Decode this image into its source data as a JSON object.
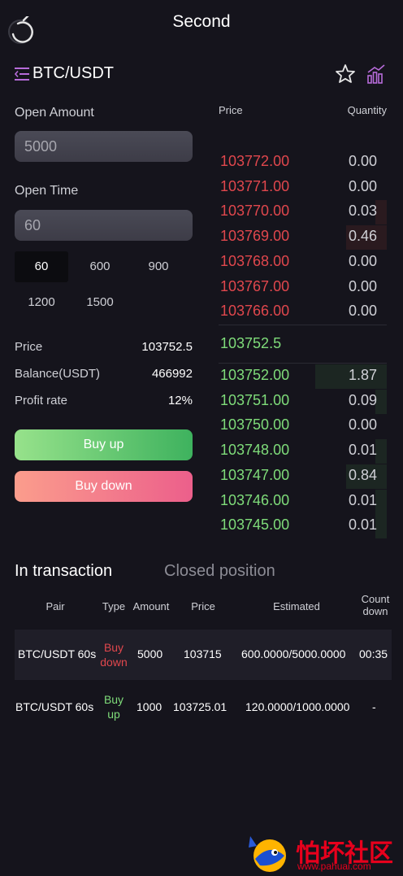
{
  "header": {
    "title": "Second"
  },
  "pair": {
    "name": "BTC/USDT"
  },
  "form": {
    "open_amount_label": "Open Amount",
    "open_amount_value": "5000",
    "open_time_label": "Open Time",
    "open_time_value": "60",
    "time_options": [
      "60",
      "600",
      "900",
      "1200",
      "1500"
    ],
    "selected_time": "60"
  },
  "info": {
    "price_label": "Price",
    "price_value": "103752.5",
    "balance_label": "Balance(USDT)",
    "balance_value": "466992",
    "profit_label": "Profit rate",
    "profit_value": "12%"
  },
  "buttons": {
    "buy_up": "Buy up",
    "buy_down": "Buy down"
  },
  "orderbook": {
    "price_header": "Price",
    "quantity_header": "Quantity",
    "asks": [
      {
        "price": "103772.00",
        "qty": "0.00",
        "depth": 0
      },
      {
        "price": "103771.00",
        "qty": "0.00",
        "depth": 0
      },
      {
        "price": "103770.00",
        "qty": "0.03",
        "depth": 0.03
      },
      {
        "price": "103769.00",
        "qty": "0.46",
        "depth": 0.46
      },
      {
        "price": "103768.00",
        "qty": "0.00",
        "depth": 0
      },
      {
        "price": "103767.00",
        "qty": "0.00",
        "depth": 0
      },
      {
        "price": "103766.00",
        "qty": "0.00",
        "depth": 0
      }
    ],
    "mid_price": "103752.5",
    "bids": [
      {
        "price": "103752.00",
        "qty": "1.87",
        "depth": 1.87
      },
      {
        "price": "103751.00",
        "qty": "0.09",
        "depth": 0.09
      },
      {
        "price": "103750.00",
        "qty": "0.00",
        "depth": 0
      },
      {
        "price": "103748.00",
        "qty": "0.01",
        "depth": 0.01
      },
      {
        "price": "103747.00",
        "qty": "0.84",
        "depth": 0.84
      },
      {
        "price": "103746.00",
        "qty": "0.01",
        "depth": 0.01
      },
      {
        "price": "103745.00",
        "qty": "0.01",
        "depth": 0.01
      }
    ]
  },
  "tabs": {
    "active": "In transaction",
    "inactive": "Closed position"
  },
  "table": {
    "headers": {
      "pair": "Pair",
      "type": "Type",
      "amount": "Amount",
      "price": "Price",
      "estimated": "Estimated",
      "countdown_1": "Count",
      "countdown_2": "down"
    },
    "rows": [
      {
        "pair": "BTC/USDT 60s",
        "type_1": "Buy",
        "type_2": "down",
        "direction": "down",
        "amount": "5000",
        "price": "103715",
        "estimated": "600.0000/5000.0000",
        "countdown": "00:35"
      },
      {
        "pair": "BTC/USDT 60s",
        "type_1": "Buy",
        "type_2": "up",
        "direction": "up",
        "amount": "1000",
        "price": "103725.01",
        "estimated": "120.0000/1000.0000",
        "countdown": "-"
      }
    ]
  },
  "watermark": {
    "text": "怕坏社区",
    "url": "www.pahuai.com"
  },
  "colors": {
    "ask": "#e0474d",
    "bid": "#7fdc7a",
    "background": "#15141c"
  }
}
